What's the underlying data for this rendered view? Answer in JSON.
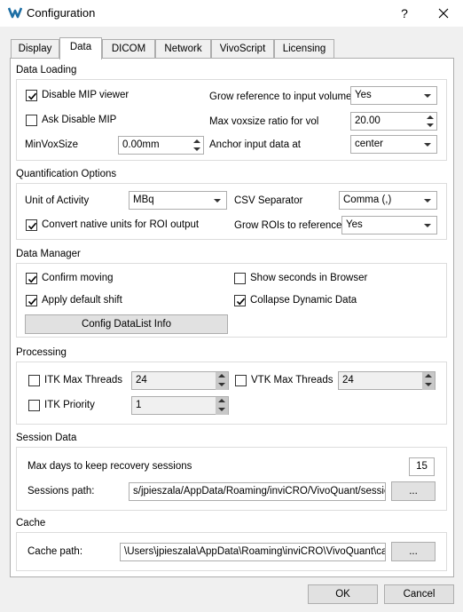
{
  "window": {
    "title": "Configuration",
    "help_glyph": "?"
  },
  "tabs": [
    {
      "label": "Display"
    },
    {
      "label": "Data"
    },
    {
      "label": "DICOM"
    },
    {
      "label": "Network"
    },
    {
      "label": "VivoScript"
    },
    {
      "label": "Licensing"
    }
  ],
  "active_tab": "Data",
  "data_loading": {
    "title": "Data Loading",
    "disable_mip": {
      "label": "Disable MIP viewer",
      "checked": true
    },
    "ask_disable_mip": {
      "label": "Ask Disable MIP",
      "checked": false
    },
    "min_vox_size": {
      "label": "MinVoxSize",
      "value": "0.00mm"
    },
    "grow_reference": {
      "label": "Grow reference to input volume",
      "value": "Yes"
    },
    "max_voxsize_ratio": {
      "label": "Max voxsize ratio for vol",
      "value": "20.00"
    },
    "anchor_input": {
      "label": "Anchor input data at",
      "value": "center"
    }
  },
  "quantification": {
    "title": "Quantification Options",
    "unit_of_activity": {
      "label": "Unit of Activity",
      "value": "MBq"
    },
    "csv_separator": {
      "label": "CSV Separator",
      "value": "Comma (,)"
    },
    "convert_native": {
      "label": "Convert native units for ROI output",
      "checked": true
    },
    "grow_rois": {
      "label": "Grow ROIs to reference",
      "value": "Yes"
    }
  },
  "data_manager": {
    "title": "Data Manager",
    "confirm_moving": {
      "label": "Confirm moving",
      "checked": true
    },
    "show_seconds": {
      "label": "Show seconds in Browser",
      "checked": false
    },
    "apply_default_shift": {
      "label": "Apply default shift",
      "checked": true
    },
    "collapse_dynamic": {
      "label": "Collapse Dynamic Data",
      "checked": true
    },
    "config_button": "Config DataList Info"
  },
  "processing": {
    "title": "Processing",
    "itk_max_threads": {
      "label": "ITK Max Threads",
      "checked": false,
      "value": "24"
    },
    "vtk_max_threads": {
      "label": "VTK Max Threads",
      "checked": false,
      "value": "24"
    },
    "itk_priority": {
      "label": "ITK Priority",
      "checked": false,
      "value": "1"
    }
  },
  "session_data": {
    "title": "Session Data",
    "max_days": {
      "label": "Max days to keep recovery sessions",
      "value": "15"
    },
    "sessions_path": {
      "label": "Sessions path:",
      "value": "s/jpieszala/AppData/Roaming/inviCRO/VivoQuant/sessions"
    },
    "browse_label": "..."
  },
  "cache": {
    "title": "Cache",
    "cache_path": {
      "label": "Cache path:",
      "value": "\\Users\\jpieszala\\AppData\\Roaming\\inviCRO\\VivoQuant\\cache"
    },
    "browse_label": "..."
  },
  "footer": {
    "ok_label": "OK",
    "cancel_label": "Cancel"
  },
  "colors": {
    "accent": "#1c6ea4",
    "window_bg": "#f0f0f0",
    "panel_bg": "#ffffff",
    "border": "#adadad"
  }
}
